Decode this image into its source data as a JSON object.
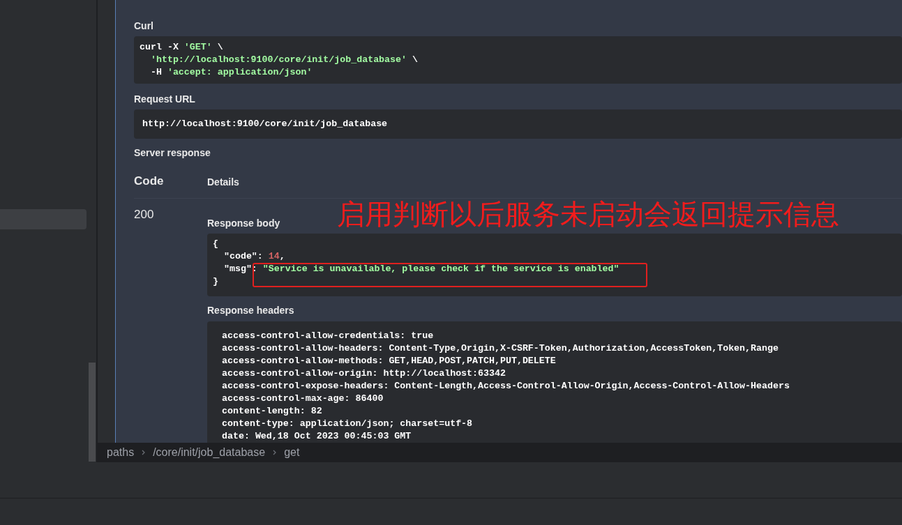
{
  "curl": {
    "label": "Curl",
    "lines": [
      [
        {
          "kind": "plain",
          "text": "curl -X "
        },
        {
          "kind": "string",
          "text": "'GET'"
        },
        {
          "kind": "plain",
          "text": " \\"
        }
      ],
      [
        {
          "kind": "string",
          "text": "  'http://localhost:9100/core/init/job_database'"
        },
        {
          "kind": "plain",
          "text": " \\"
        }
      ],
      [
        {
          "kind": "plain",
          "text": "  -H "
        },
        {
          "kind": "string",
          "text": "'accept: application/json'"
        }
      ]
    ]
  },
  "request_url": {
    "label": "Request URL",
    "value": "http://localhost:9100/core/init/job_database"
  },
  "server_response": {
    "label": "Server response",
    "columns": [
      "Code",
      "Details"
    ],
    "code": "200",
    "body": {
      "label": "Response body",
      "lines": [
        [
          {
            "kind": "plain",
            "text": "{"
          }
        ],
        [
          {
            "kind": "plain",
            "text": "  \"code\": "
          },
          {
            "kind": "number",
            "text": "14"
          },
          {
            "kind": "plain",
            "text": ","
          }
        ],
        [
          {
            "kind": "plain",
            "text": "  \"msg\": "
          },
          {
            "kind": "string",
            "text": "\"Service is unavailable, please check if the service is enabled\""
          }
        ],
        [
          {
            "kind": "plain",
            "text": "}"
          }
        ]
      ]
    },
    "headers": {
      "label": "Response headers",
      "lines": [
        "access-control-allow-credentials: true",
        "access-control-allow-headers: Content-Type,Origin,X-CSRF-Token,Authorization,AccessToken,Token,Range",
        "access-control-allow-methods: GET,HEAD,POST,PATCH,PUT,DELETE",
        "access-control-allow-origin: http://localhost:63342",
        "access-control-expose-headers: Content-Length,Access-Control-Allow-Origin,Access-Control-Allow-Headers",
        "access-control-max-age: 86400",
        "content-length: 82",
        "content-type: application/json; charset=utf-8",
        "date: Wed,18 Oct 2023 00:45:03 GMT"
      ]
    }
  },
  "breadcrumb": [
    "paths",
    "/core/init/job_database",
    "get"
  ],
  "annotation": {
    "text": "启用判断以后服务未启动会返回提示信息"
  }
}
